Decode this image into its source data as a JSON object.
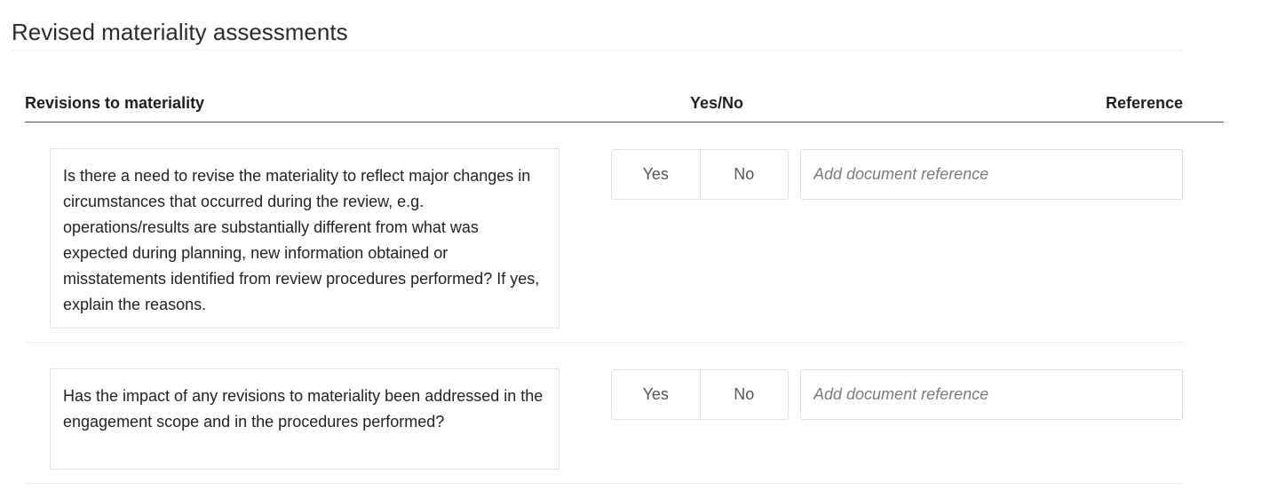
{
  "section": {
    "title": "Revised materiality assessments"
  },
  "table": {
    "headers": {
      "question": "Revisions to materiality",
      "yesno": "Yes/No",
      "reference": "Reference"
    },
    "rows": [
      {
        "question": "Is there a need to revise the materiality to reflect major changes in circumstances that occurred during the review, e.g. operations/results are substantially different from what was expected during planning, new information obtained or misstatements identified from review procedures performed? If yes, explain the reasons.",
        "yes_label": "Yes",
        "no_label": "No",
        "reference_value": "",
        "reference_placeholder": "Add document reference"
      },
      {
        "question": "Has the impact of any revisions to materiality been addressed in the engagement scope and in the procedures performed?",
        "yes_label": "Yes",
        "no_label": "No",
        "reference_value": "",
        "reference_placeholder": "Add document reference"
      }
    ]
  }
}
